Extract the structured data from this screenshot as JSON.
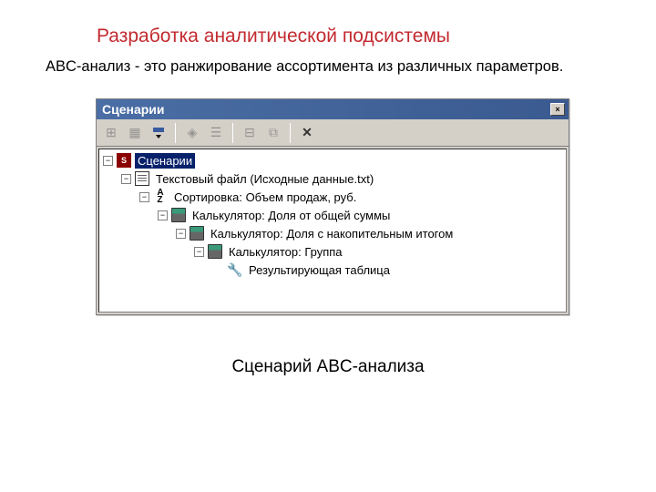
{
  "page": {
    "title": "Разработка аналитической подсистемы",
    "subtitle": "ABC-анализ - это ранжирование ассортимента из различных параметров.",
    "caption": "Сценарий ABC-анализа"
  },
  "window": {
    "title": "Сценарии",
    "close": "×"
  },
  "toolbar": {
    "icons": [
      "tree-icon",
      "grid-icon",
      "dropdown-icon",
      "cube-icon",
      "list-icon",
      "hierarchy-icon",
      "group-icon",
      "delete-icon"
    ]
  },
  "tree": {
    "root": {
      "label": "Сценарии",
      "icon": "scenarios"
    },
    "nodes": [
      {
        "label": "Текстовый файл (Исходные данные.txt)",
        "icon": "text-file",
        "indent": 1
      },
      {
        "label": "Сортировка: Объем продаж, руб.",
        "icon": "sort",
        "indent": 2
      },
      {
        "label": "Калькулятор: Доля от общей суммы",
        "icon": "calc",
        "indent": 3
      },
      {
        "label": "Калькулятор: Доля с накопительным итогом",
        "icon": "calc",
        "indent": 4
      },
      {
        "label": "Калькулятор: Группа",
        "icon": "calc",
        "indent": 5
      },
      {
        "label": "Результирующая таблица",
        "icon": "wrench",
        "indent": 6
      }
    ]
  }
}
